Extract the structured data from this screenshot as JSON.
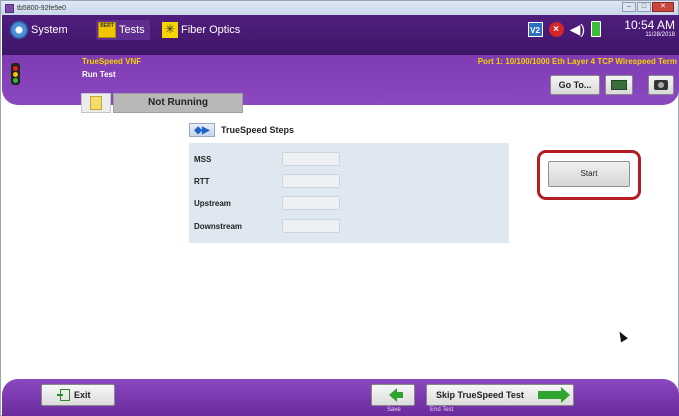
{
  "window": {
    "title": "tb5800-92fe5e0",
    "controls": [
      "–",
      "□",
      "✕"
    ]
  },
  "menubar": {
    "items": [
      {
        "label": "System",
        "icon": "gear-icon"
      },
      {
        "label": "Tests",
        "icon": "bert-icon",
        "icon_text": "BERT"
      },
      {
        "label": "Fiber Optics",
        "icon": "fiber-optics-icon"
      }
    ],
    "status_icons": [
      "v2-icon",
      "alarm-x-icon",
      "speaker-icon",
      "battery-icon"
    ],
    "v2_text": "V2",
    "clock_time": "10:54 AM",
    "clock_date": "11/28/2018"
  },
  "header": {
    "test_name": "TrueSpeed VNF",
    "subtitle": "Run Test",
    "port": "Port 1: 10/100/1000 Eth Layer 4 TCP Wirespeed Term",
    "goto_label": "Go To...",
    "traffic_light_colors": [
      "#e02020",
      "#f2c500",
      "#33bb33"
    ]
  },
  "status": {
    "text": "Not Running"
  },
  "steps": {
    "title": "TrueSpeed Steps",
    "items": [
      {
        "label": "MSS",
        "value": ""
      },
      {
        "label": "RTT",
        "value": ""
      },
      {
        "label": "Upstream",
        "value": ""
      },
      {
        "label": "Downstream",
        "value": ""
      }
    ]
  },
  "actions": {
    "start_label": "Start",
    "highlight_color": "#b41c22"
  },
  "footer": {
    "exit_label": "Exit",
    "skip_label": "Skip TrueSpeed Test",
    "save_label": "Save",
    "end_test_label": "End Test"
  }
}
